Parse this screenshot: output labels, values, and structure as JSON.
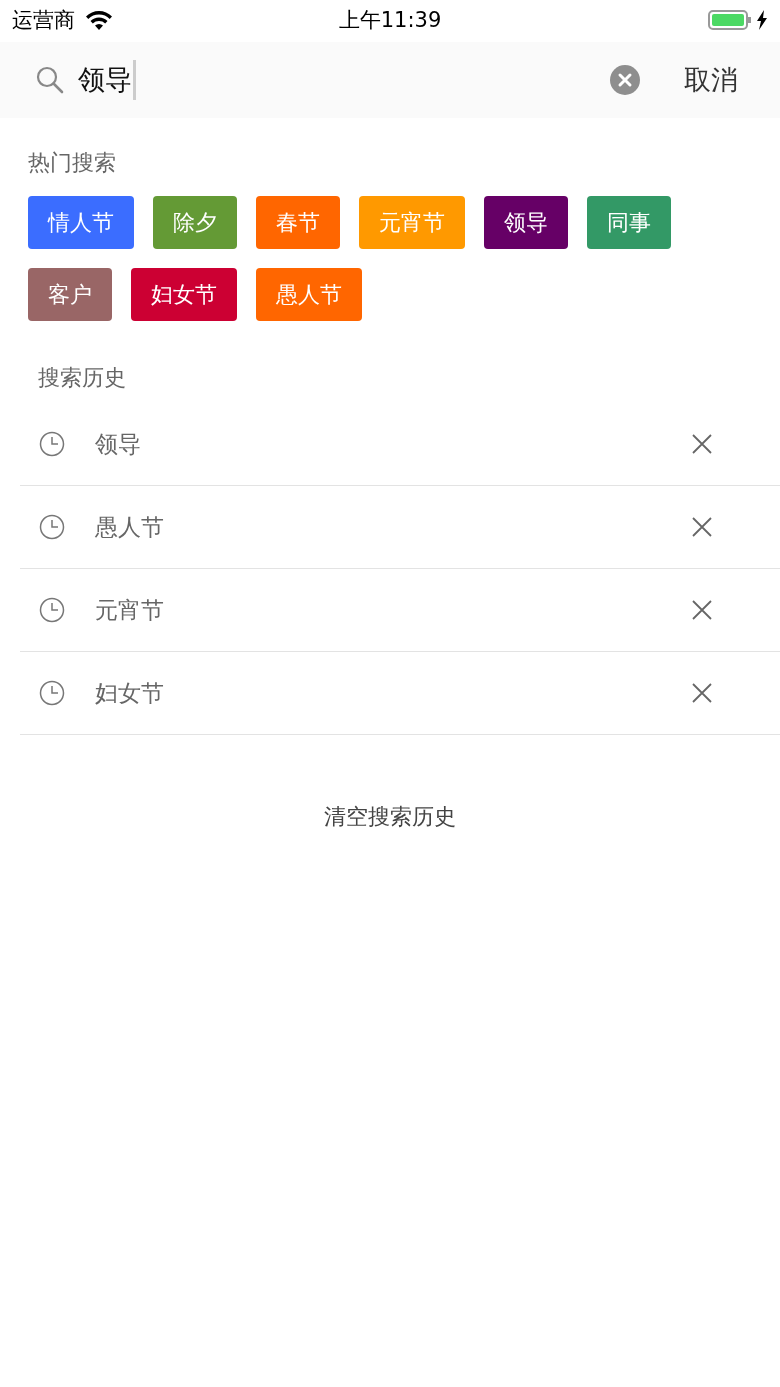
{
  "status_bar": {
    "carrier": "运营商",
    "time": "上午11:39"
  },
  "search": {
    "value": "领导",
    "cancel": "取消"
  },
  "hot_search": {
    "title": "热门搜索",
    "tags": [
      {
        "label": "情人节",
        "color": "#3b6dff"
      },
      {
        "label": "除夕",
        "color": "#649a35"
      },
      {
        "label": "春节",
        "color": "#ff6600"
      },
      {
        "label": "元宵节",
        "color": "#ff9900"
      },
      {
        "label": "领导",
        "color": "#660066"
      },
      {
        "label": "同事",
        "color": "#339966"
      },
      {
        "label": "客户",
        "color": "#996666"
      },
      {
        "label": "妇女节",
        "color": "#cc0033"
      },
      {
        "label": "愚人节",
        "color": "#ff6600"
      }
    ]
  },
  "history": {
    "title": "搜索历史",
    "items": [
      {
        "label": "领导"
      },
      {
        "label": "愚人节"
      },
      {
        "label": "元宵节"
      },
      {
        "label": "妇女节"
      }
    ],
    "clear": "清空搜索历史"
  }
}
